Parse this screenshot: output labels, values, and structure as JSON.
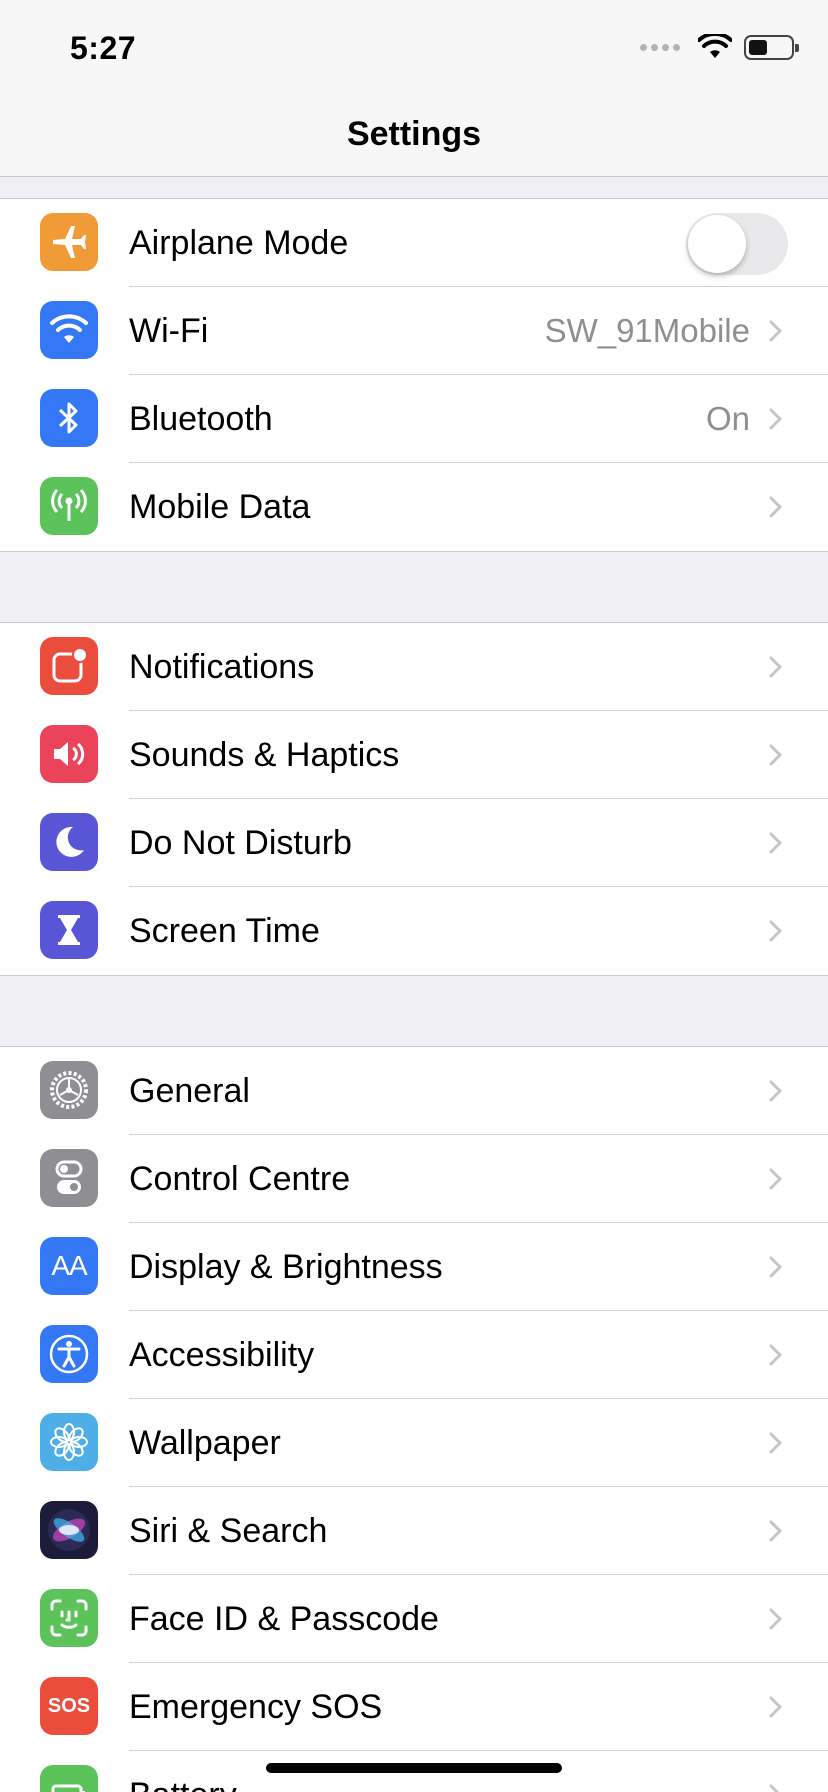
{
  "status_bar": {
    "time": "5:27"
  },
  "nav": {
    "title": "Settings"
  },
  "groups": [
    {
      "items": [
        {
          "label": "Airplane Mode",
          "color": "#f19a38",
          "icon": "airplane-icon",
          "toggle": false
        },
        {
          "label": "Wi-Fi",
          "value": "SW_91Mobile",
          "color": "#3478f6",
          "icon": "wifi-icon"
        },
        {
          "label": "Bluetooth",
          "value": "On",
          "color": "#3478f6",
          "icon": "bluetooth-icon"
        },
        {
          "label": "Mobile Data",
          "color": "#5cc25a",
          "icon": "antenna-icon"
        }
      ]
    },
    {
      "items": [
        {
          "label": "Notifications",
          "color": "#eb4d3d",
          "icon": "notifications-icon"
        },
        {
          "label": "Sounds & Haptics",
          "color": "#eb445a",
          "icon": "speaker-icon"
        },
        {
          "label": "Do Not Disturb",
          "color": "#5856d6",
          "icon": "moon-icon"
        },
        {
          "label": "Screen Time",
          "color": "#5856d6",
          "icon": "hourglass-icon"
        }
      ]
    },
    {
      "items": [
        {
          "label": "General",
          "color": "#8e8e93",
          "icon": "gear-icon"
        },
        {
          "label": "Control Centre",
          "color": "#8e8e93",
          "icon": "switches-icon"
        },
        {
          "label": "Display & Brightness",
          "color": "#3478f6",
          "icon": "text-size-icon",
          "icon_text": "AA"
        },
        {
          "label": "Accessibility",
          "color": "#3478f6",
          "icon": "accessibility-icon"
        },
        {
          "label": "Wallpaper",
          "color": "#4eaee8",
          "icon": "flower-icon"
        },
        {
          "label": "Siri & Search",
          "color": "#1c1c3a",
          "icon": "siri-icon"
        },
        {
          "label": "Face ID & Passcode",
          "color": "#5cc25a",
          "icon": "face-id-icon"
        },
        {
          "label": "Emergency SOS",
          "color": "#eb4d3d",
          "icon": "sos-icon",
          "icon_text": "SOS"
        },
        {
          "label": "Battery",
          "color": "#5cc25a",
          "icon": "battery-icon"
        }
      ]
    }
  ]
}
